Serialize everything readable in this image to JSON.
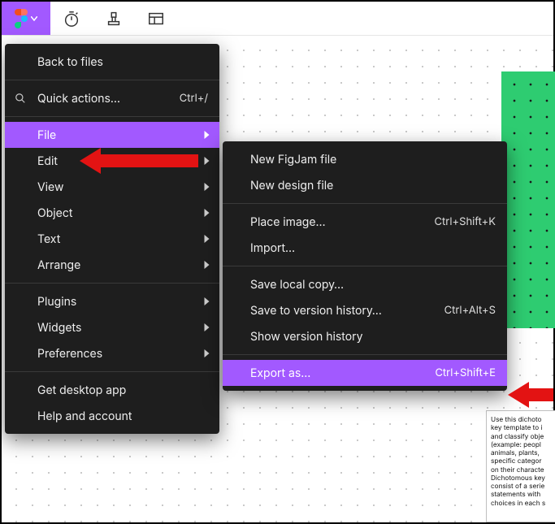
{
  "toolbar": {
    "logo": "figma",
    "tools": [
      "timer",
      "stamp",
      "table"
    ]
  },
  "menu": {
    "back": "Back to files",
    "quick_actions": {
      "label": "Quick actions…",
      "shortcut": "Ctrl+/"
    },
    "file": "File",
    "edit": "Edit",
    "view": "View",
    "object": "Object",
    "text": "Text",
    "arrange": "Arrange",
    "plugins": "Plugins",
    "widgets": "Widgets",
    "preferences": "Preferences",
    "desktop": "Get desktop app",
    "help": "Help and account"
  },
  "file_submenu": {
    "new_figjam": "New FigJam file",
    "new_design": "New design file",
    "place_image": {
      "label": "Place image…",
      "shortcut": "Ctrl+Shift+K"
    },
    "import": "Import…",
    "save_local": "Save local copy…",
    "save_version": {
      "label": "Save to version history…",
      "shortcut": "Ctrl+Alt+S"
    },
    "show_history": "Show version history",
    "export": {
      "label": "Export as…",
      "shortcut": "Ctrl+Shift+E"
    }
  },
  "note_text": "Use this dichoto key template to i and classify obje (example: peopl animals, plants, specific categor on their characte Dichotomous key consist of a serie statements with choices in each s"
}
